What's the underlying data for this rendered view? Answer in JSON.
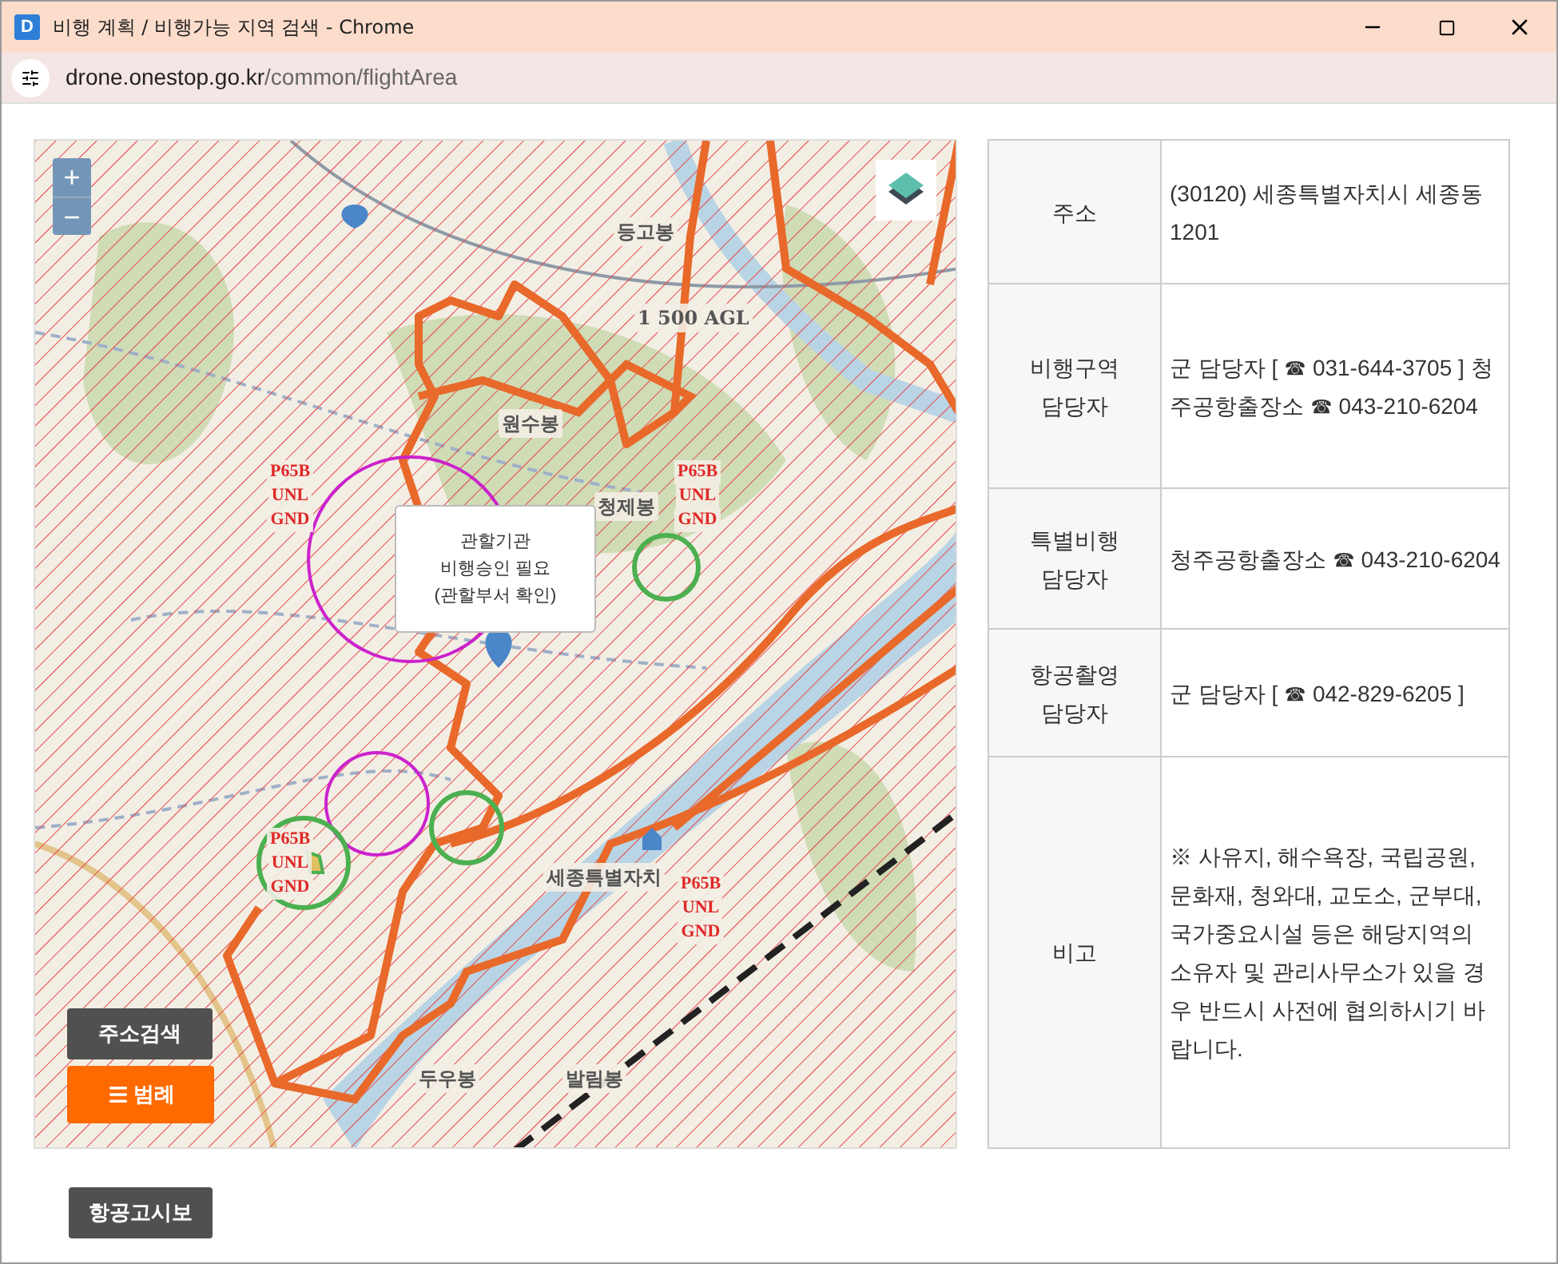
{
  "window": {
    "title": "비행 계획 / 비행가능 지역 검색 - Chrome",
    "app_letter": "D",
    "url_host": "drone.onestop.go.kr",
    "url_path": "/common/flightArea"
  },
  "map": {
    "zoom_in": "+",
    "zoom_out": "−",
    "popup": [
      "관할기관",
      "비행승인 필요",
      "(관할부서 확인)"
    ],
    "place_labels": [
      "등고봉",
      "1 500 AGL",
      "원수봉",
      "청제봉",
      "세종특별자치",
      "두우봉",
      "발림봉"
    ],
    "airspace_labels": [
      {
        "lines": [
          "P65B",
          "UNL",
          "GND"
        ]
      },
      {
        "lines": [
          "P65B",
          "UNL",
          "GND"
        ]
      },
      {
        "lines": [
          "P65B",
          "UNL",
          "GND"
        ]
      },
      {
        "lines": [
          "P65B",
          "UNL",
          "GND"
        ]
      }
    ],
    "buttons": [
      "주소검색",
      "범례"
    ]
  },
  "info_table": [
    {
      "label": "주소",
      "value": "(30120) 세종특별자치시 세종동 1201"
    },
    {
      "label": "비행구역 담당자",
      "value": "군 담당자 [ ☎ 031-644-3705 ] 청주공항출장소 ☎ 043-210-6204"
    },
    {
      "label": "특별비행 담당자",
      "value": "청주공항출장소 ☎ 043-210-6204"
    },
    {
      "label": "항공촬영 담당자",
      "value": "군 담당자 [ ☎ 042-829-6205 ]"
    },
    {
      "label": "비고",
      "value": "※ 사유지, 해수욕장, 국립공원, 문화재, 청와대, 교도소, 군부대, 국가중요시설 등은 해당지역의 소유자 및 관리사무소가 있을 경우 반드시 사전에 협의하시기 바랍니다."
    }
  ],
  "footer_button": "항공고시보"
}
